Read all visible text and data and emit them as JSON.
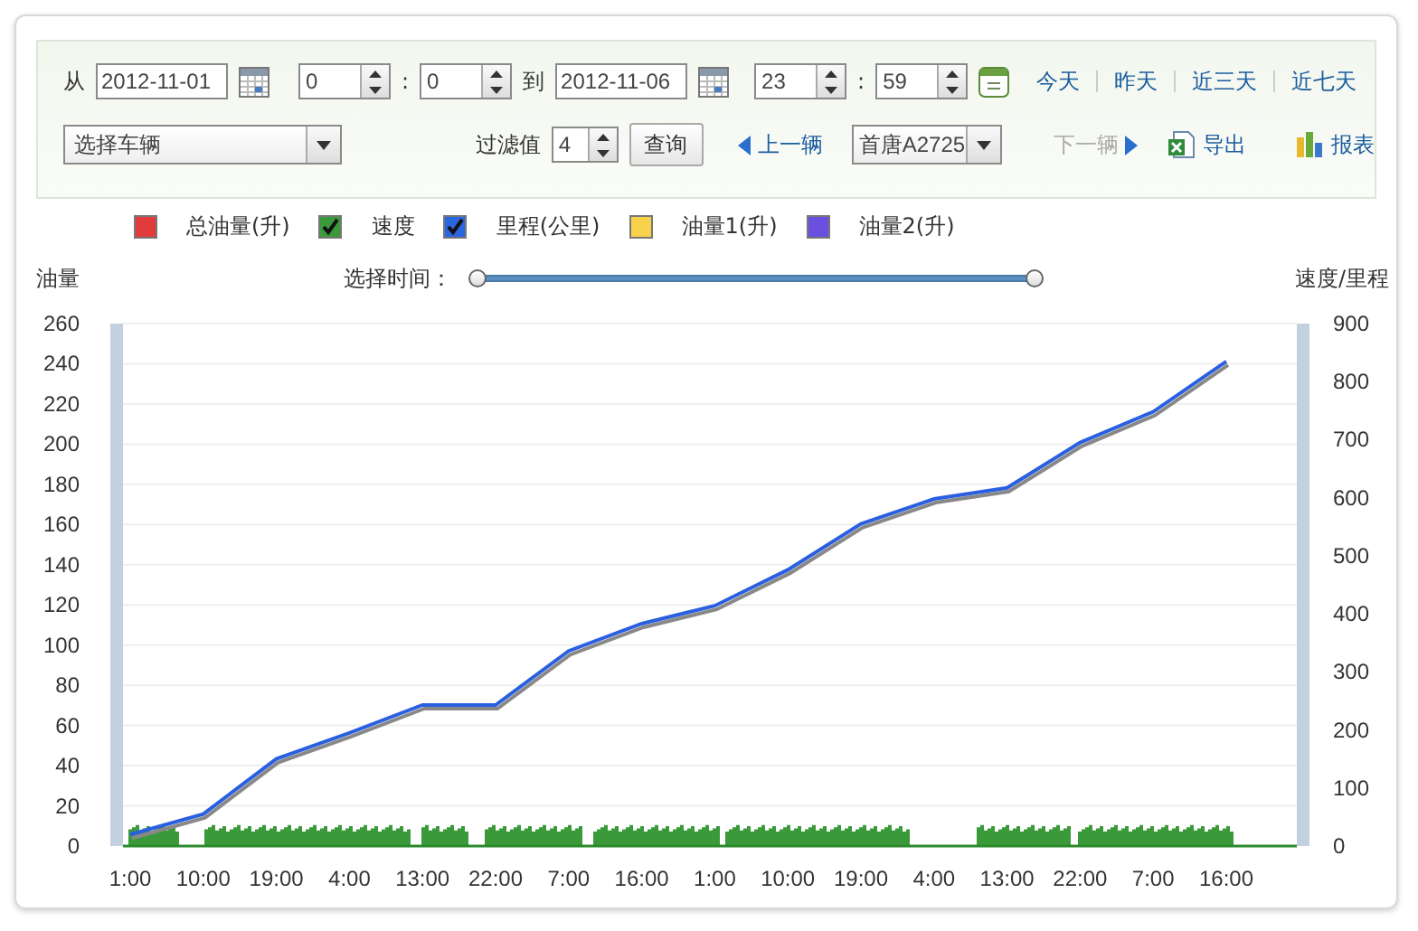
{
  "toolbar": {
    "from_label": "从",
    "from_date": "2012-11-01",
    "from_time": {
      "hour": "0",
      "separator": ":",
      "minute": "0"
    },
    "to_label": "到",
    "to_date": "2012-11-06",
    "to_time": {
      "hour": "23",
      "separator": ":",
      "minute": "59"
    },
    "quick_ranges": [
      {
        "label": "今天"
      },
      {
        "label": "昨天"
      },
      {
        "label": "近三天"
      },
      {
        "label": "近七天"
      }
    ],
    "vehicle_select": {
      "value": "选择车辆"
    },
    "filter": {
      "label": "过滤值",
      "value": "4"
    },
    "query_button": "查询",
    "prev_link": {
      "label": "上一辆",
      "disabled": false
    },
    "plate_select": {
      "value": "首唐A2725"
    },
    "next_link": {
      "label": "下一辆",
      "disabled": true
    },
    "export_link": "导出",
    "report_link": "报表"
  },
  "legend": [
    {
      "label": "总油量(升)",
      "color": "#e03a3a",
      "checked": false
    },
    {
      "label": "速度",
      "color": "#3a9a3a",
      "checked": true
    },
    {
      "label": "里程(公里)",
      "color": "#2a66e0",
      "checked": true
    },
    {
      "label": "油量1(升)",
      "color": "#f7d24a",
      "checked": false
    },
    {
      "label": "油量2(升)",
      "color": "#6a4fe0",
      "checked": false
    }
  ],
  "time_slider": {
    "label": "选择时间：",
    "thumbs": [
      {
        "level": 0
      },
      {
        "level": 1
      }
    ]
  },
  "chart": {
    "left_axis": {
      "title": "油量",
      "ticks": [
        "260",
        "240",
        "220",
        "200",
        "180",
        "160",
        "140",
        "120",
        "100",
        "80",
        "60",
        "40",
        "20",
        "0"
      ]
    },
    "chart_data": {
      "type": "line",
      "ylabel": "速度/里程",
      "categories": [
        "1:00",
        "10:00",
        "19:00",
        "4:00",
        "13:00",
        "22:00",
        "7:00",
        "16:00",
        "1:00",
        "10:00",
        "19:00",
        "4:00",
        "13:00",
        "22:00",
        "7:00",
        "16:00"
      ],
      "ylim": [
        0,
        900
      ],
      "yticks": [
        0,
        100,
        200,
        300,
        400,
        500,
        600,
        700,
        800,
        900
      ],
      "series": [
        {
          "color": "#2a5fe0",
          "values": [
            20,
            55,
            150,
            195,
            243,
            243,
            336,
            383,
            414,
            476,
            555,
            598,
            617,
            695,
            748,
            835
          ]
        }
      ]
    }
  }
}
